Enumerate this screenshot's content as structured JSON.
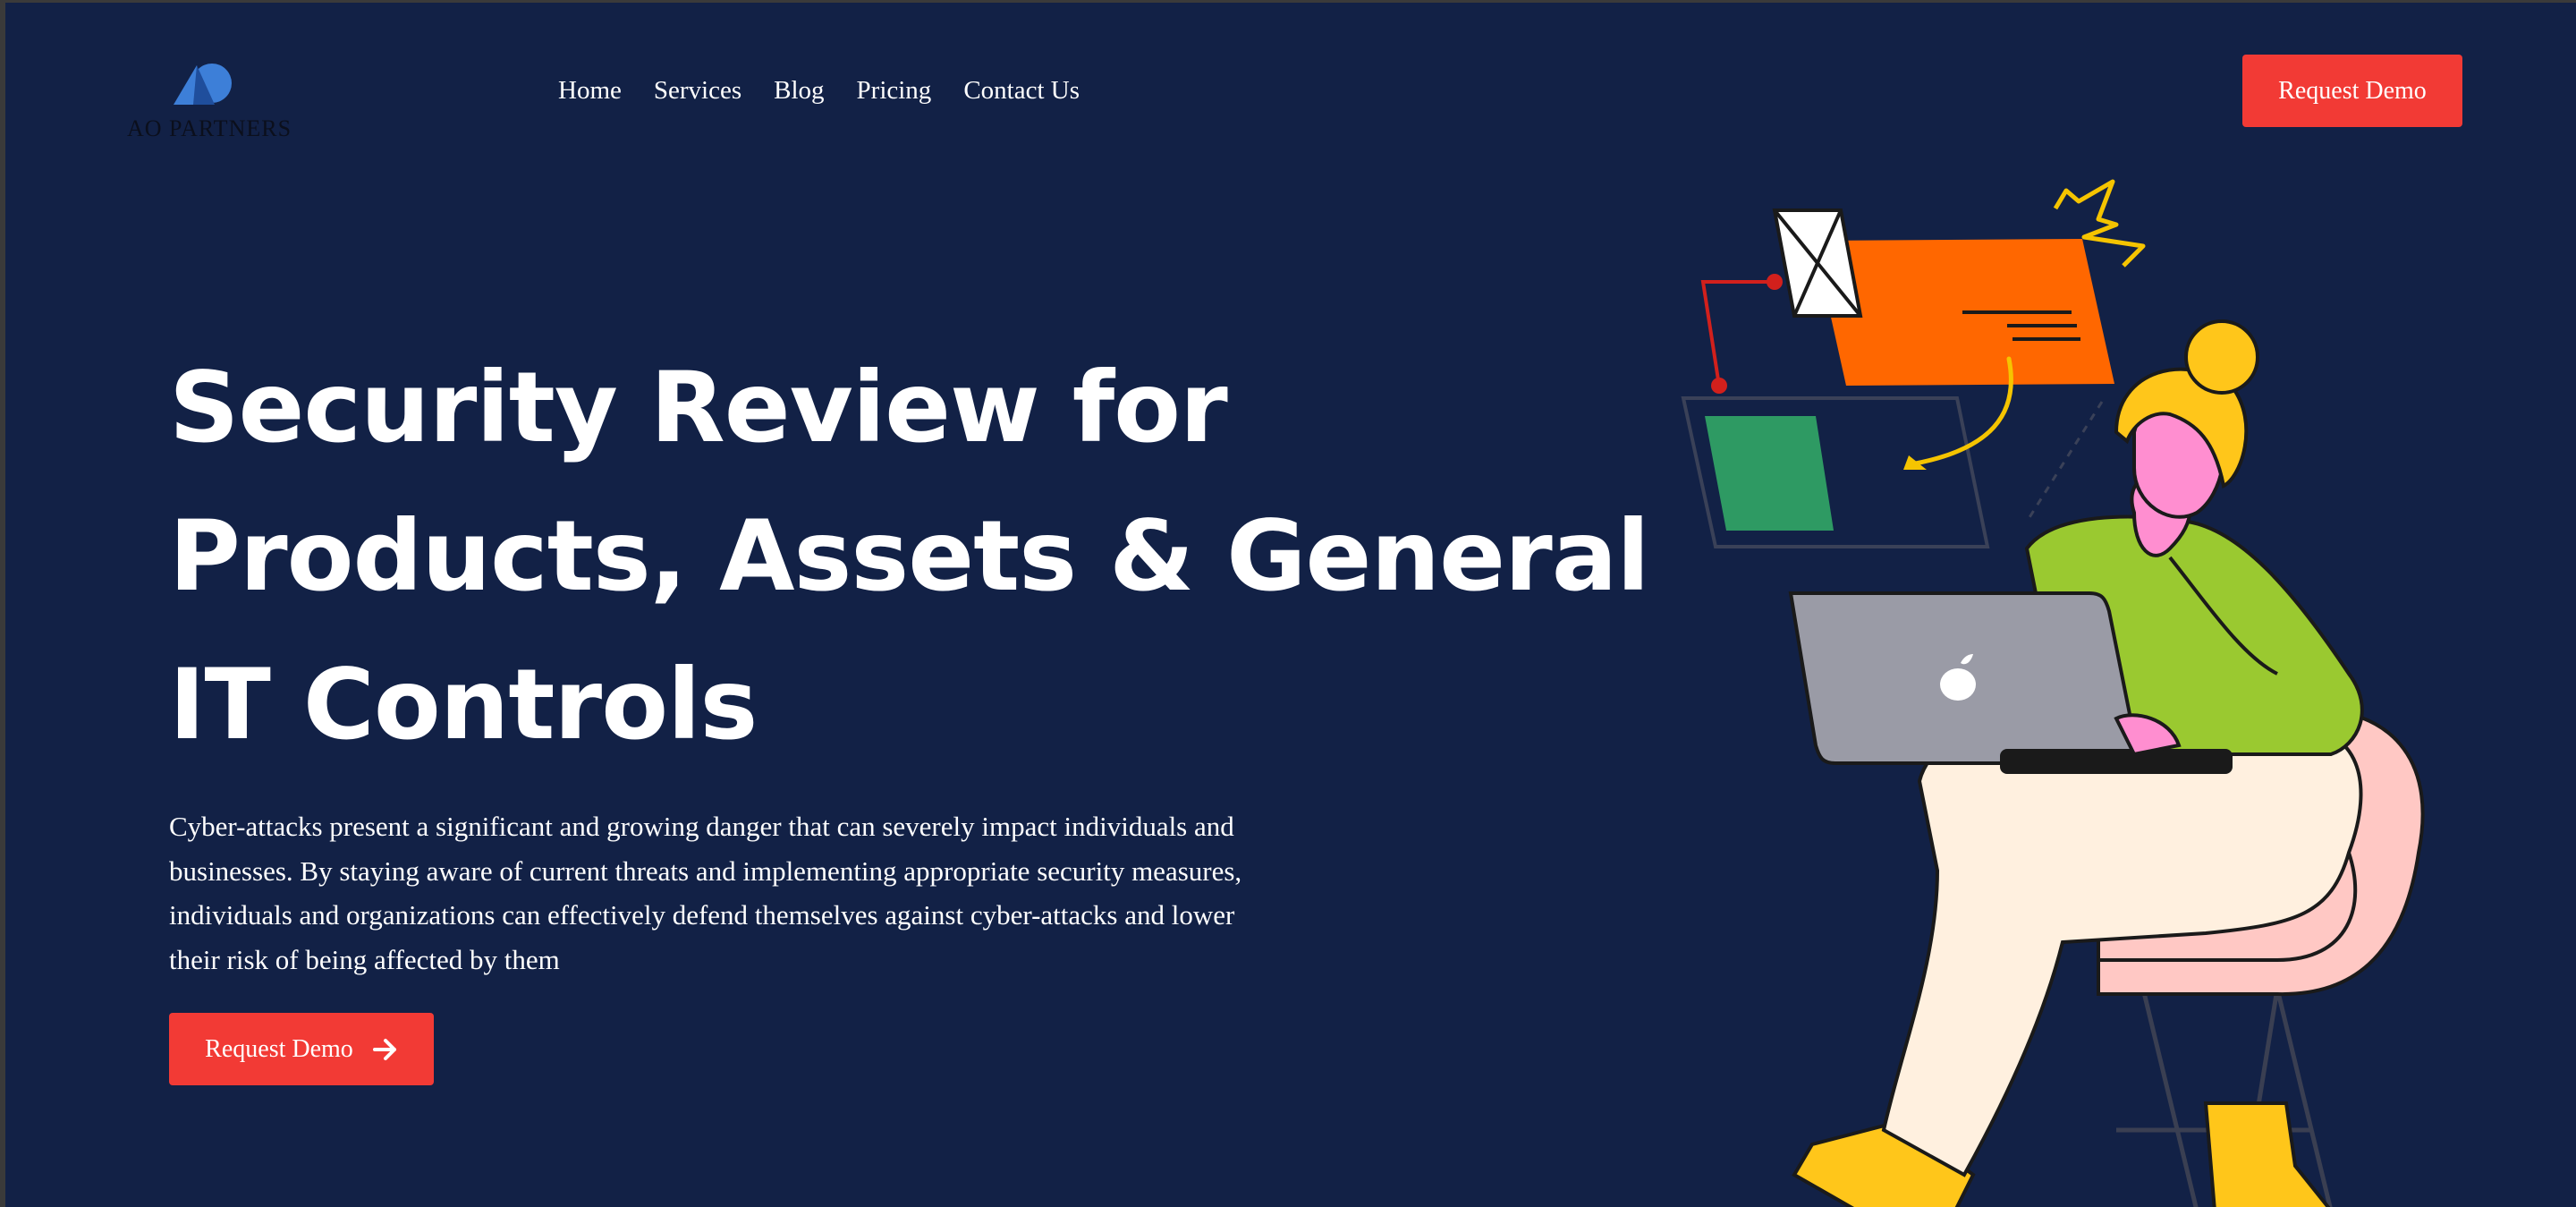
{
  "brand": {
    "name": "AO PARTNERS"
  },
  "nav": {
    "items": [
      "Home",
      "Services",
      "Blog",
      "Pricing",
      "Contact Us"
    ]
  },
  "header": {
    "cta_label": "Request Demo"
  },
  "hero": {
    "title_lines": [
      "Security Review for",
      "Products, Assets & General",
      "IT Controls"
    ],
    "description": "Cyber-attacks present a significant and growing danger that can severely impact individuals and businesses. By staying aware of current threats and implementing appropriate security measures, individuals and organizations can effectively defend themselves against cyber-attacks and lower their risk of being affected by them",
    "cta_label": "Request Demo",
    "cta_icon": "arrow-right-icon"
  },
  "colors": {
    "background": "#122146",
    "accent": "#f23a35",
    "text": "#ffffff"
  }
}
